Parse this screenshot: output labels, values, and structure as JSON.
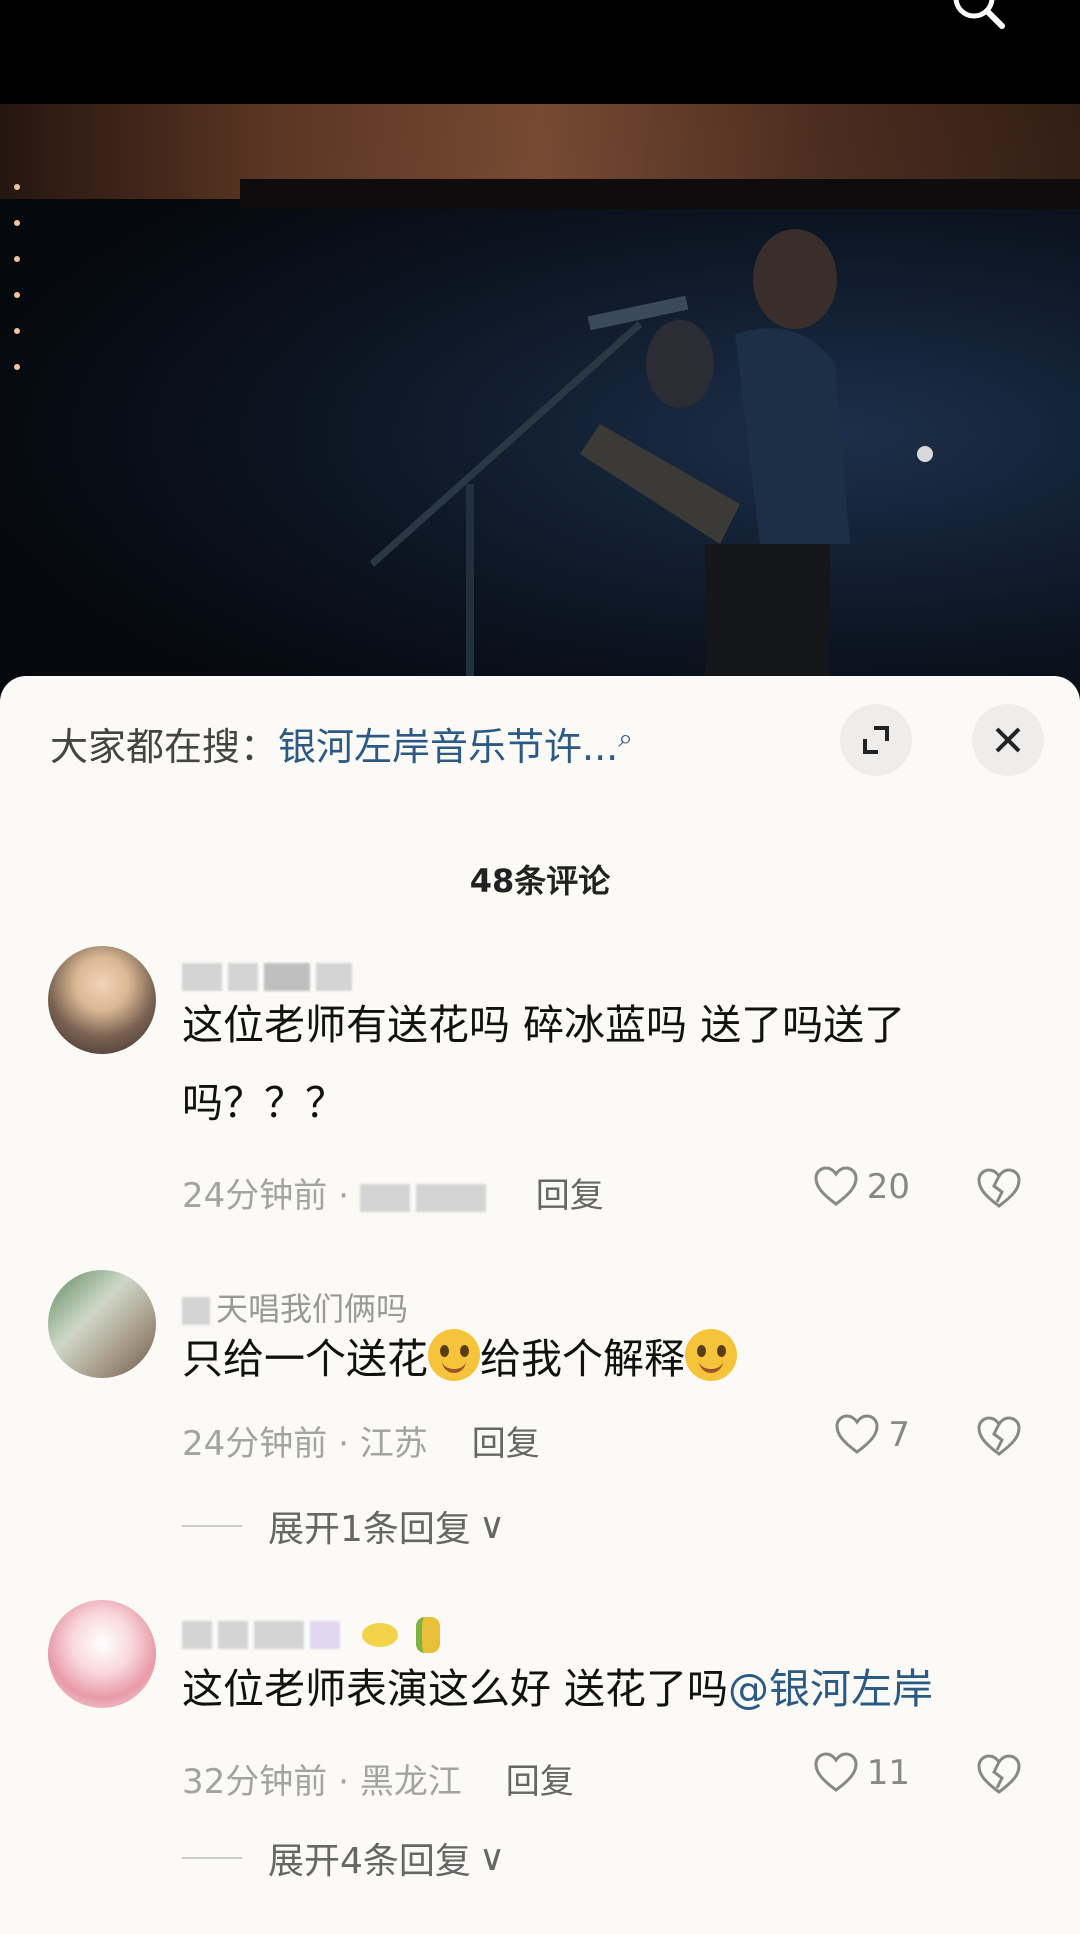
{
  "search_bar": {
    "prefix": "大家都在搜：",
    "query": "银河左岸音乐节许..."
  },
  "comments_header": {
    "count_label": "48条评论"
  },
  "comments": [
    {
      "text": "这位老师有送花吗  碎冰蓝吗  送了吗送了吗？？？",
      "time": "24分钟前",
      "reply_label": "回复",
      "likes": "20"
    },
    {
      "username_visible": "天唱我们俩吗",
      "text_part1": "只给一个送花",
      "text_part2": "给我个解释",
      "time": "24分钟前",
      "location": "江苏",
      "reply_label": "回复",
      "likes": "7",
      "expand_label": "展开1条回复"
    },
    {
      "text": "这位老师表演这么好 送花了吗",
      "mention": "@银河左岸",
      "time": "32分钟前",
      "location": "黑龙江",
      "reply_label": "回复",
      "likes": "11",
      "expand_label": "展开4条回复"
    }
  ],
  "colors": {
    "link": "#2c5a86",
    "sheet_bg": "#fbfaf7"
  }
}
